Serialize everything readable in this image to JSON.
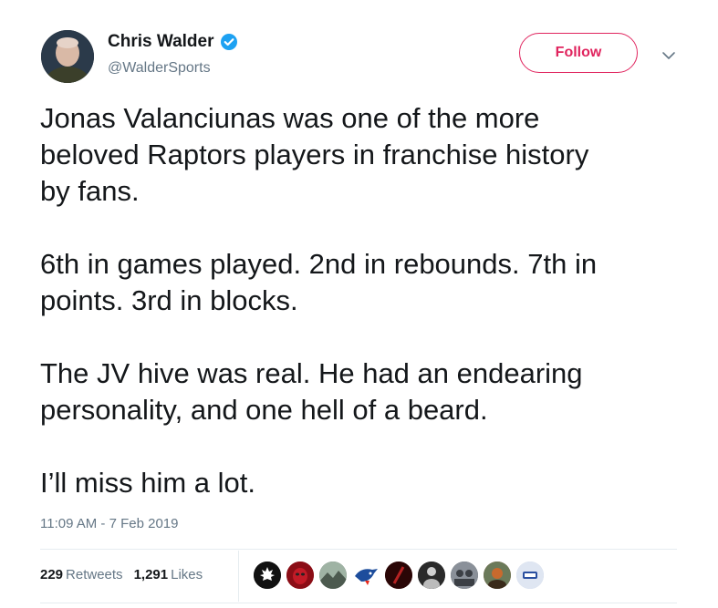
{
  "author": {
    "display_name": "Chris Walder",
    "handle": "@WalderSports",
    "verified": true,
    "avatar_icon": "person-avatar"
  },
  "actions": {
    "follow_label": "Follow",
    "more_icon": "chevron-down-icon",
    "accent": "#e0245e"
  },
  "tweet": {
    "text": "Jonas Valanciunas was one of the more\nbeloved Raptors players in franchise history\nby fans.\n\n6th in games played. 2nd in rebounds. 7th in\npoints. 3rd in blocks.\n\nThe JV hive was real. He had an endearing\npersonality, and one hell of a beard.\n\nI’ll miss him a lot.",
    "timestamp": "11:09 AM - 7 Feb 2019"
  },
  "stats": {
    "retweets_count": "229",
    "retweets_label": "Retweets",
    "likes_count": "1,291",
    "likes_label": "Likes"
  },
  "likers": [
    {
      "icon": "maple-leaf-avatar",
      "color": "#111111"
    },
    {
      "icon": "red-mask-avatar",
      "color": "#8b0d16"
    },
    {
      "icon": "landscape-avatar",
      "color": "#6a7a6e"
    },
    {
      "icon": "blue-jay-avatar",
      "color": "#1d4d9c"
    },
    {
      "icon": "dark-red-avatar",
      "color": "#3a0c0c"
    },
    {
      "icon": "player-avatar",
      "color": "#2a2a2a"
    },
    {
      "icon": "group-photo-avatar",
      "color": "#5a5f66"
    },
    {
      "icon": "orange-photo-avatar",
      "color": "#7a4a2a"
    },
    {
      "icon": "hockey-logo-avatar",
      "color": "#c9d3e6"
    }
  ]
}
